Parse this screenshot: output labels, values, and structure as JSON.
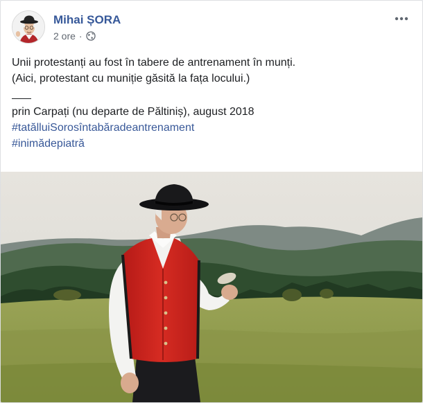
{
  "post": {
    "author": "Mihai ȘORA",
    "time": "2 ore",
    "separator": "·",
    "privacy_icon": "globe-icon",
    "more_icon": "ellipsis-icon",
    "lines": [
      "Unii protestanți au fost în tabere de antrenament în munți.",
      "(Aici, protestant cu muniție găsită la fața locului.)"
    ],
    "location_line": "prin Carpați (nu departe de Păltiniș), august 2018",
    "hashtags": [
      "#tatălluiSorosîntabăradeantrenament",
      "#inimădepiatră"
    ]
  },
  "colors": {
    "author": "#365899",
    "hashtag": "#385898",
    "meta": "#606770",
    "text": "#1c1e21"
  }
}
